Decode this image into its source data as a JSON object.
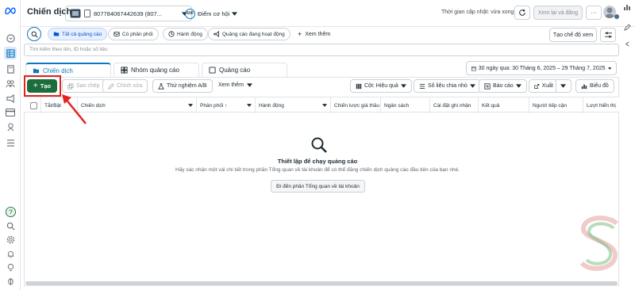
{
  "header": {
    "title": "Chiến dịch",
    "account_id": "807784067442639 (807...",
    "score_label": "Điểm cơ hội",
    "score_badge": "100",
    "updated_text": "Thời gian cập nhật: vừa xong",
    "review_publish_label": "Xem lại và đăng",
    "more_label": "···"
  },
  "filters": {
    "all_ads": "Tất cả quảng cáo",
    "has_delivery": "Có phân phối",
    "actions": "Hành động",
    "active_ads": "Quảng cáo đang hoạt động",
    "see_more": "Xem thêm",
    "create_view": "Tạo chế độ xem"
  },
  "search": {
    "placeholder": "Tìm kiếm theo tên, ID hoặc số liệu"
  },
  "tabs": [
    {
      "label": "Chiến dịch"
    },
    {
      "label": "Nhóm quảng cáo"
    },
    {
      "label": "Quảng cáo"
    }
  ],
  "date_range": "30 ngày qua: 30 Tháng 6, 2025 – 29 Tháng 7, 2025",
  "toolbar": {
    "create": "Tạo",
    "copy": "Sao chép",
    "edit": "Chỉnh sửa",
    "ab_test": "Thử nghiệm A/B",
    "more": "Xem thêm",
    "columns": "Cột: Hiệu quả",
    "breakdown": "Số liệu chia nhỏ",
    "reports": "Báo cáo",
    "export": "Xuất",
    "charts": "Biểu đồ"
  },
  "table": {
    "columns": [
      "Tắt/Bật",
      "Chiến dịch",
      "Phân phối ↑",
      "Hành động",
      "Chiến lược giá thầu",
      "Ngân sách",
      "Cài đặt ghi nhận",
      "Kết quả",
      "Người tiếp cận",
      "Lượt hiển thị"
    ]
  },
  "empty_state": {
    "title": "Thiết lập để chạy quảng cáo",
    "description": "Hãy xác nhận một vài chi tiết trong phần Tổng quan về tài khoản để có thể đăng chiến dịch quảng cáo đầu tiên của bạn nhé.",
    "button": "Đi đến phần Tổng quan về tài khoản"
  },
  "colors": {
    "create_green": "#1b6d3c",
    "accent_blue": "#0a78be",
    "annotation_red": "#e3231e"
  },
  "icons": {
    "meta_logo": "meta-logo-icon",
    "search": "search-icon",
    "calendar": "calendar-icon",
    "watermark": "s-logo-watermark"
  }
}
